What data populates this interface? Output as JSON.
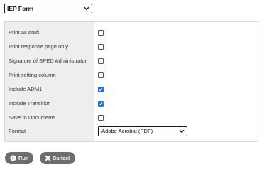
{
  "form_select": {
    "value": "IEP Form"
  },
  "settings": {
    "rows": [
      {
        "label": "Print as draft",
        "checked": false
      },
      {
        "label": "Print response page only",
        "checked": false
      },
      {
        "label": "Signature of SPED Administrator",
        "checked": false
      },
      {
        "label": "Print setting column",
        "checked": false
      },
      {
        "label": "Include ADM1",
        "checked": true
      },
      {
        "label": "Include Transition",
        "checked": true
      },
      {
        "label": "Save to Documents",
        "checked": false
      }
    ],
    "format": {
      "label": "Format",
      "value": "Adobe Acrobat (PDF)"
    }
  },
  "actions": {
    "run_label": "Run",
    "cancel_label": "Cancel"
  },
  "colors": {
    "checkbox_checked": "#1a73e8",
    "button_bg": "#6d6d6d",
    "label_column_bg": "#eeeeee"
  }
}
